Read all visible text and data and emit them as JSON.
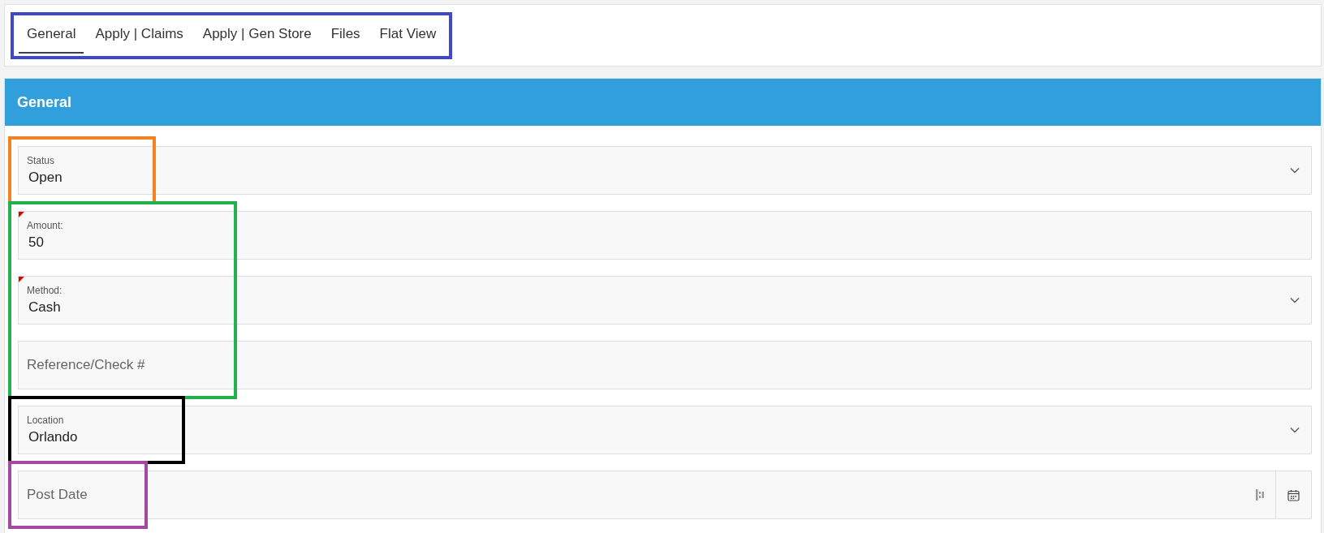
{
  "tabs": [
    {
      "label": "General",
      "selected": true
    },
    {
      "label": "Apply | Claims",
      "selected": false
    },
    {
      "label": "Apply | Gen Store",
      "selected": false
    },
    {
      "label": "Files",
      "selected": false
    },
    {
      "label": "Flat View",
      "selected": false
    }
  ],
  "tabs_frame": {
    "color": "#3f48cc"
  },
  "region": {
    "title": "General",
    "field_groups": [
      {
        "color": "#f58220",
        "fields": [
          {
            "kind": "select",
            "label": "Status",
            "value": "Open",
            "required": false
          }
        ]
      },
      {
        "color": "#22b14c",
        "fields": [
          {
            "kind": "text",
            "label": "Amount:",
            "value": "50",
            "required": true
          },
          {
            "kind": "select",
            "label": "Method:",
            "value": "Cash",
            "required": true
          },
          {
            "kind": "text",
            "placeholder": "Reference/Check #",
            "required": false
          }
        ]
      },
      {
        "color": "#000000",
        "fields": [
          {
            "kind": "select",
            "label": "Location",
            "value": "Orlando",
            "required": false
          }
        ]
      },
      {
        "color": "#a349a4",
        "fields": [
          {
            "kind": "date",
            "placeholder": "Post Date",
            "required": false
          }
        ]
      }
    ]
  }
}
